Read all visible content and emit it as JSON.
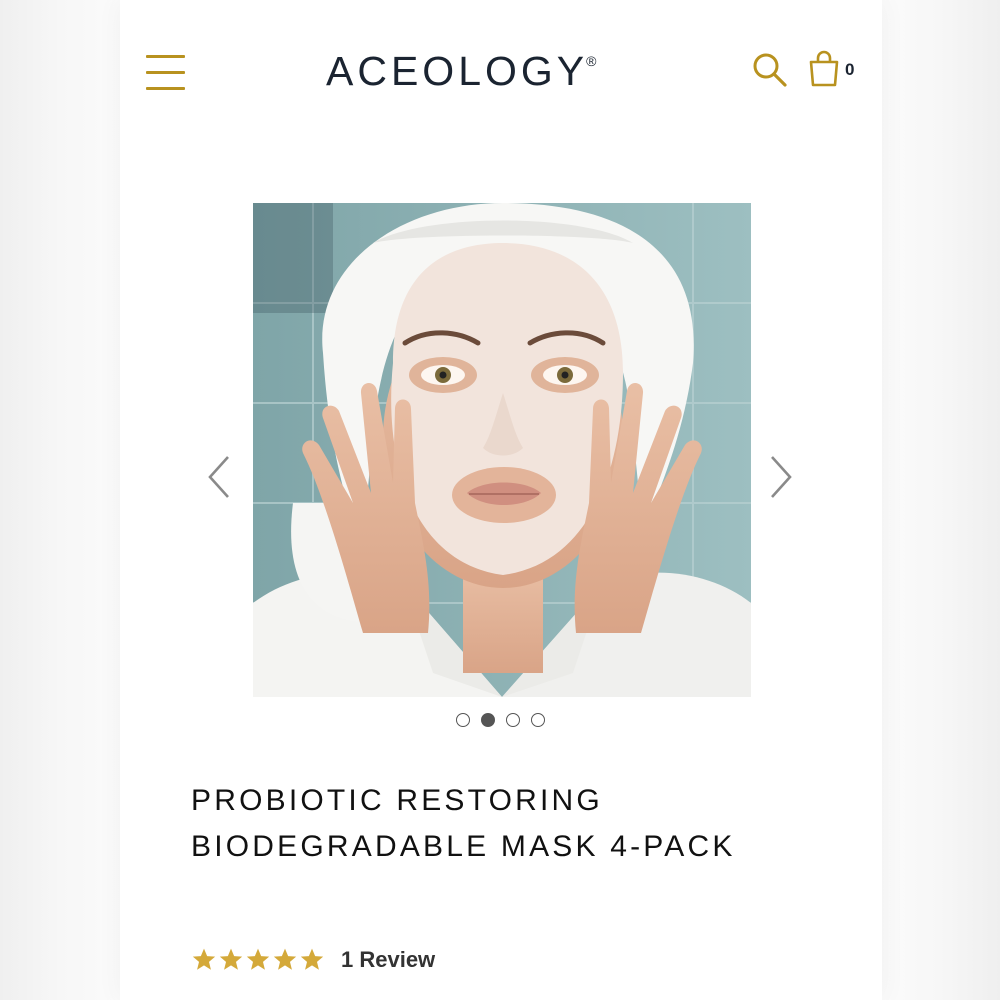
{
  "header": {
    "logo_text": "ACEOLOGY",
    "logo_mark": "®",
    "cart_count": "0",
    "icons": [
      "hamburger-menu-icon",
      "search-icon",
      "shopping-bag-icon"
    ]
  },
  "carousel": {
    "image_description": "",
    "slide_count": 4,
    "active_slide": 2,
    "icons": [
      "chevron-left-icon",
      "chevron-right-icon"
    ]
  },
  "product": {
    "title": "PROBIOTIC RESTORING BIODEGRADABLE MASK 4-PACK",
    "rating": 5,
    "review_label": "1 Review"
  },
  "colors": {
    "accent_gold": "#b8921f",
    "star_gold": "#d4a93a",
    "logo_navy": "#1b2431"
  }
}
